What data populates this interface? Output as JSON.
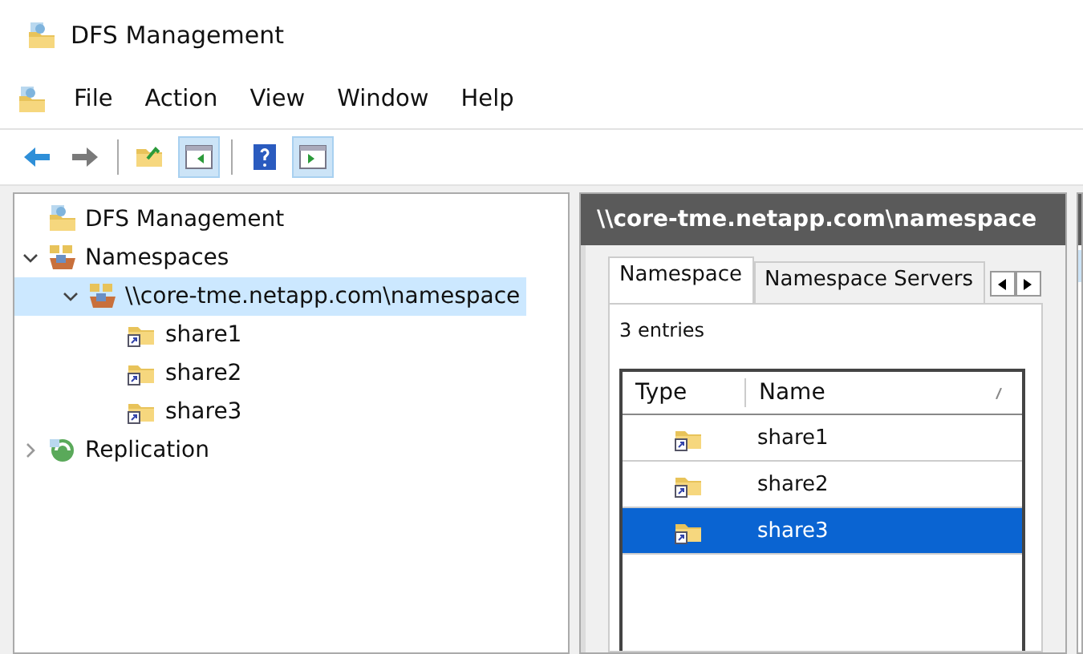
{
  "window": {
    "title": "DFS Management"
  },
  "menu": [
    "File",
    "Action",
    "View",
    "Window",
    "Help"
  ],
  "toolbar": [
    {
      "kind": "back",
      "pressed": false
    },
    {
      "kind": "forward",
      "pressed": false
    },
    {
      "kind": "sep"
    },
    {
      "kind": "up",
      "pressed": false
    },
    {
      "kind": "tree",
      "pressed": true
    },
    {
      "kind": "sep"
    },
    {
      "kind": "help",
      "pressed": false
    },
    {
      "kind": "action",
      "pressed": true
    }
  ],
  "tree": [
    {
      "label": "DFS Management",
      "kind": "root",
      "selected": false,
      "children": [
        {
          "label": "Namespaces",
          "kind": "namespaces",
          "expanded": true,
          "selected": false,
          "children": [
            {
              "label": "\\\\core-tme.netapp.com\\namespace",
              "kind": "namespace",
              "expanded": true,
              "selected": true,
              "children": [
                {
                  "label": "share1",
                  "kind": "share",
                  "selected": false
                },
                {
                  "label": "share2",
                  "kind": "share",
                  "selected": false
                },
                {
                  "label": "share3",
                  "kind": "share",
                  "selected": false
                }
              ]
            }
          ]
        },
        {
          "label": "Replication",
          "kind": "replication",
          "expanded": false,
          "selected": false
        }
      ]
    }
  ],
  "detail": {
    "title": "\\\\core-tme.netapp.com\\namespace",
    "tabs": [
      {
        "label": "Namespace",
        "selected": true
      },
      {
        "label": "Namespace Servers",
        "selected": false
      }
    ],
    "count": "3 entries",
    "columns": [
      "Type",
      "Name"
    ],
    "rows": [
      {
        "name": "share1",
        "selected": false
      },
      {
        "name": "share2",
        "selected": false
      },
      {
        "name": "share3",
        "selected": true
      }
    ]
  }
}
